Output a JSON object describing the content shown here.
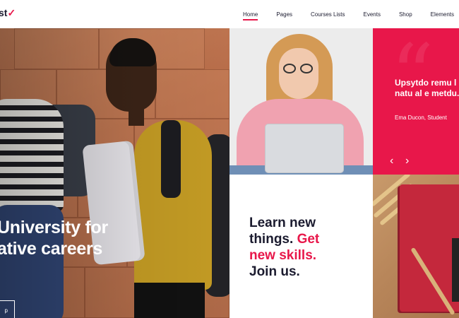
{
  "header": {
    "logo_text": "st",
    "logo_mark": "✓",
    "nav": [
      {
        "label": "Home",
        "active": true
      },
      {
        "label": "Pages",
        "active": false
      },
      {
        "label": "Courses Lists",
        "active": false
      },
      {
        "label": "Events",
        "active": false
      },
      {
        "label": "Shop",
        "active": false
      },
      {
        "label": "Elements",
        "active": false
      }
    ]
  },
  "hero": {
    "title_line1": "University for",
    "title_line2": "ative careers",
    "button_label": "p"
  },
  "testimonial": {
    "quote": "Upsytdo remu l amet, natu al e metdu.",
    "author": "Ema Ducon, Student",
    "prev_icon": "‹",
    "next_icon": "›"
  },
  "learn": {
    "line1": "Learn new",
    "line2_dark": "things. ",
    "line2_accent": "Get",
    "line3_accent": "new skills.",
    "line4": "Join us."
  },
  "colors": {
    "accent": "#e8174a",
    "dark_text": "#1b1b2f"
  }
}
